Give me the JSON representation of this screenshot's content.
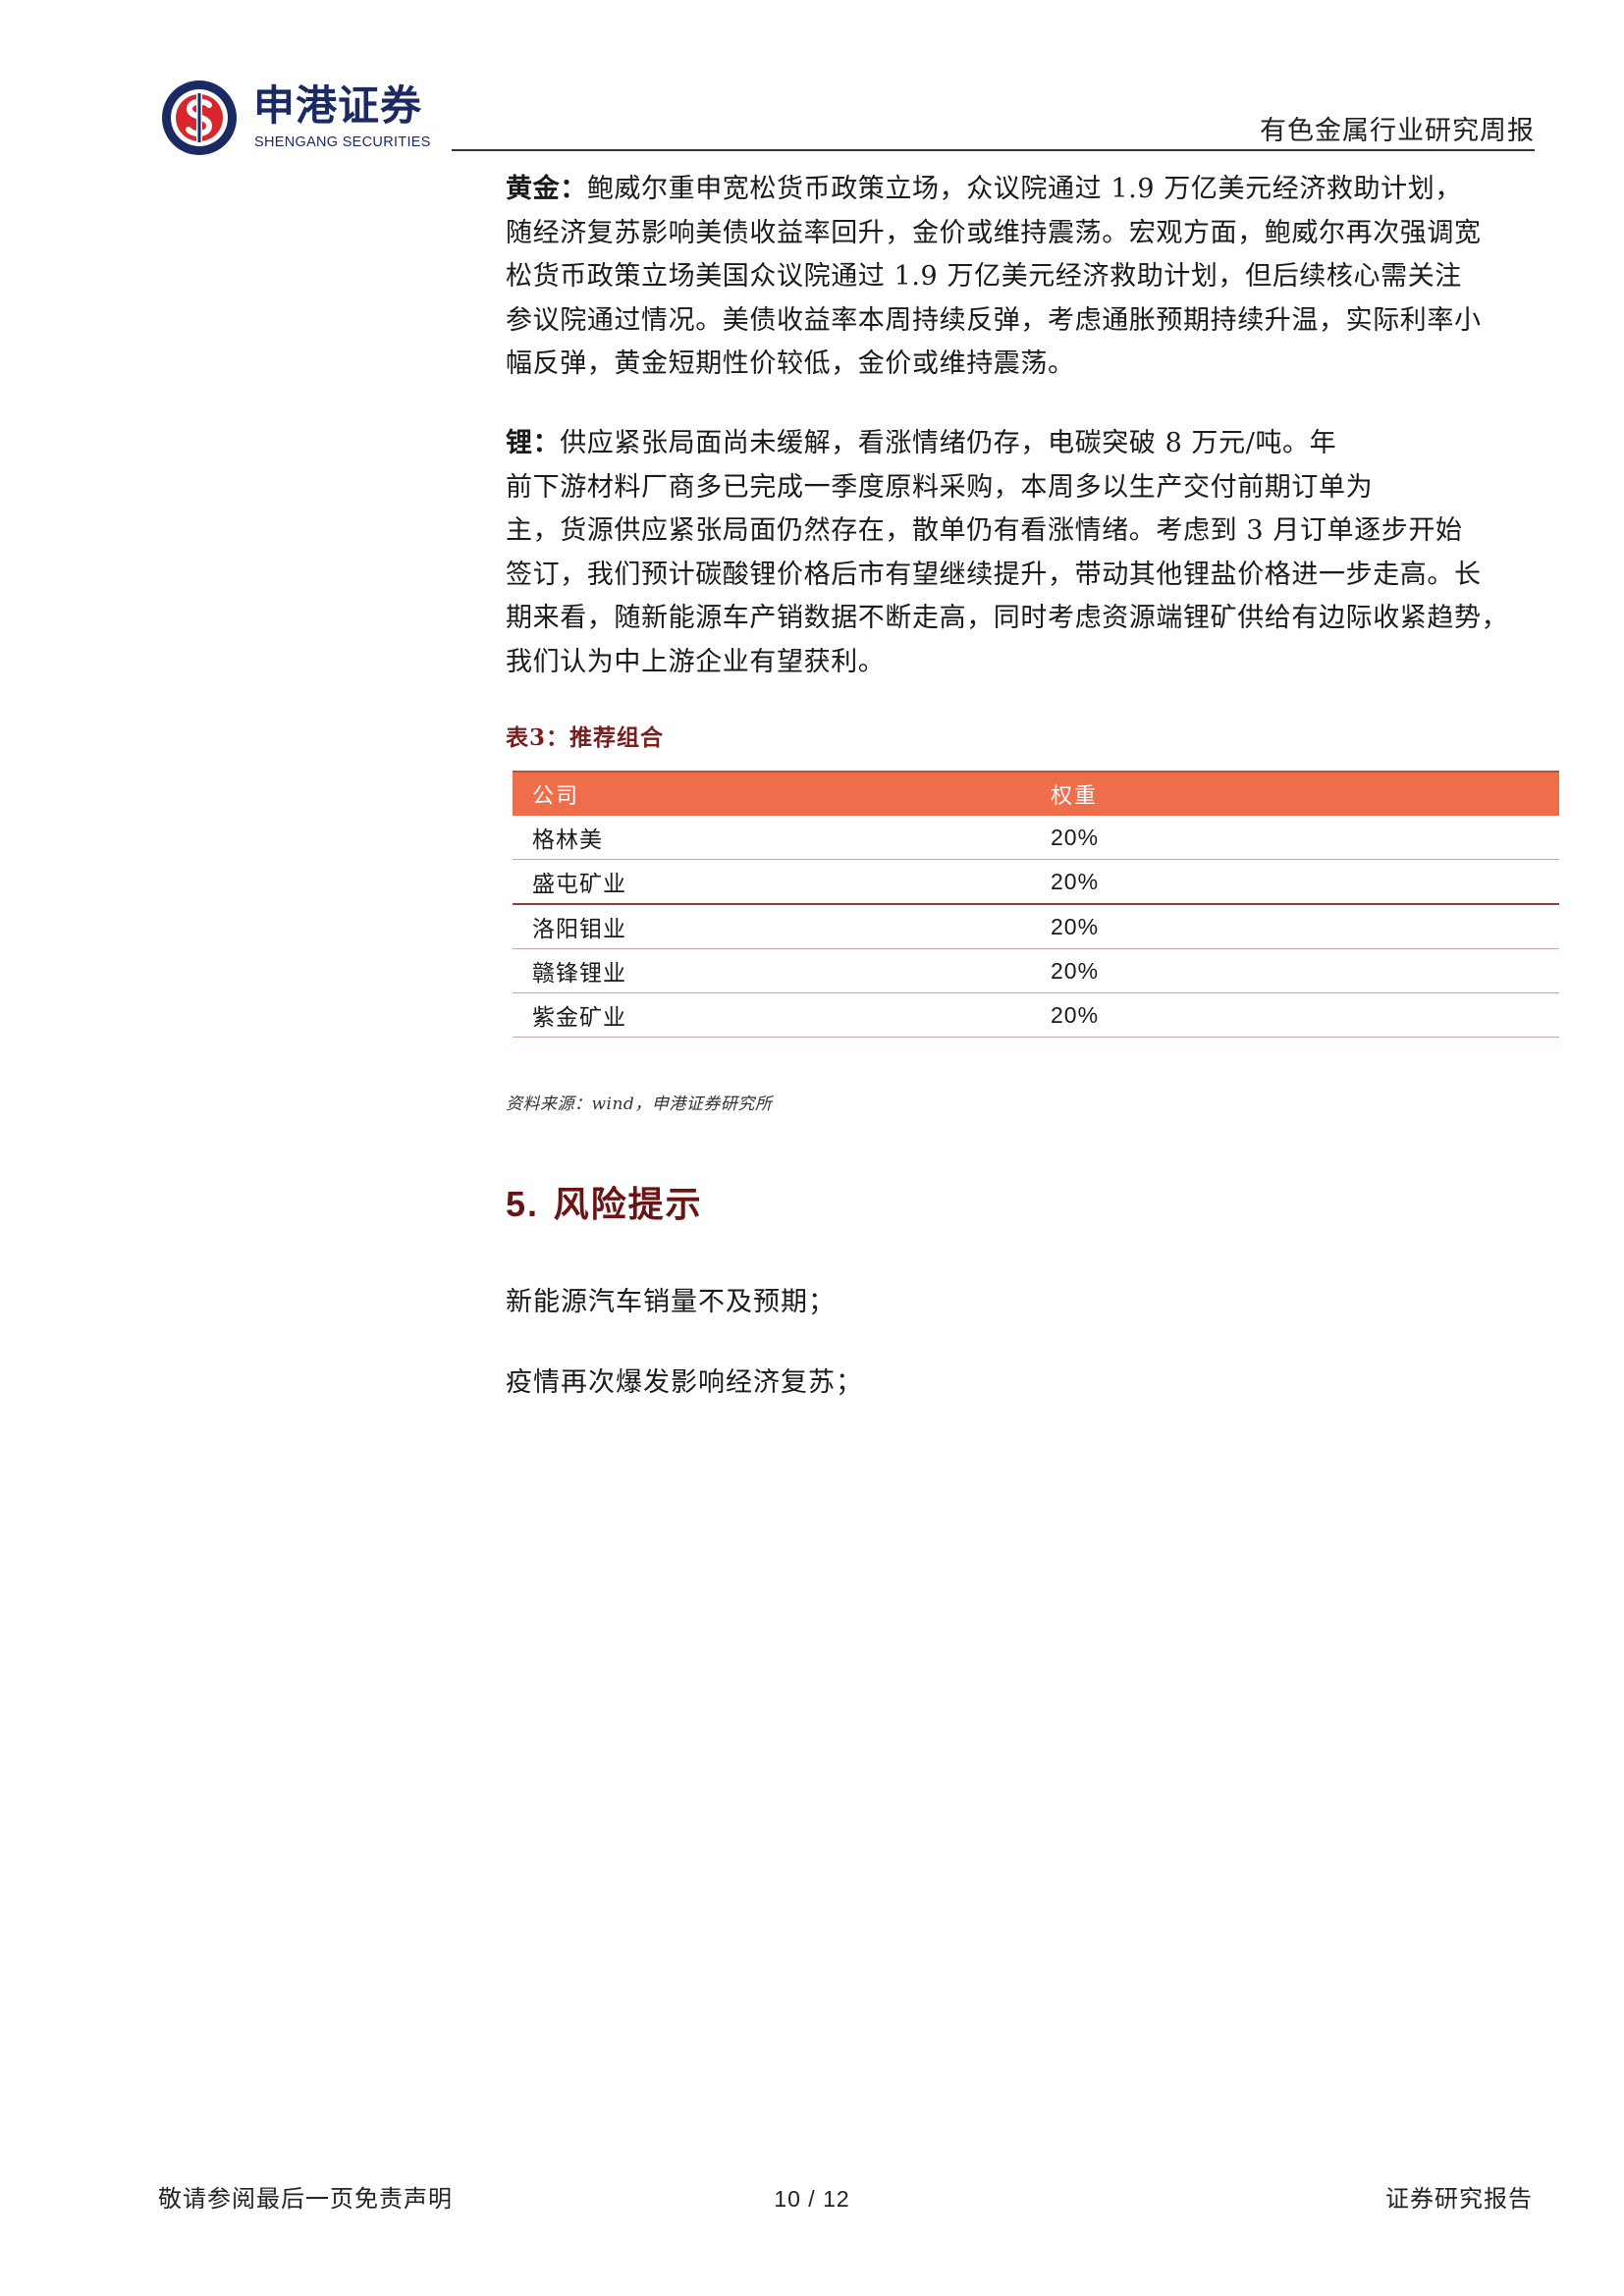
{
  "header": {
    "brand_cn": "申港证券",
    "brand_en": "SHENGANG SECURITIES",
    "report_type": "有色金属行业研究周报",
    "colors": {
      "brand_blue": "#1b2a63",
      "brand_red": "#d7262d"
    }
  },
  "gold": {
    "label": "黄金：",
    "lines": [
      "鲍威尔重申宽松货币政策立场，众议院通过 1.9 万亿美元经济救助计划，",
      "随经济复苏影响美债收益率回升，金价或维持震荡。宏观方面，鲍威尔再次强调宽",
      "松货币政策立场美国众议院通过 1.9 万亿美元经济救助计划，但后续核心需关注",
      "参议院通过情况。美债收益率本周持续反弹，考虑通胀预期持续升温，实际利率小",
      "幅反弹，黄金短期性价较低，金价或维持震荡。"
    ]
  },
  "lithium": {
    "label": "锂：",
    "lines": [
      "供应紧张局面尚未缓解，看涨情绪仍存，电碳突破 8 万元/吨。年",
      "前下游材料厂商多已完成一季度原料采购，本周多以生产交付前期订单为",
      "主，货源供应紧张局面仍然存在，散单仍有看涨情绪。考虑到 3 月订单逐步开始",
      "签订，我们预计碳酸锂价格后市有望继续提升，带动其他锂盐价格进一步走高。长",
      "期来看，随新能源车产销数据不断走高，同时考虑资源端锂矿供给有边际收紧趋势，",
      "我们认为中上游企业有望获利。"
    ]
  },
  "table": {
    "caption": "表3：推荐组合",
    "headers": [
      "公司",
      "权重"
    ],
    "rows": [
      [
        "格林美",
        "20%"
      ],
      [
        "盛屯矿业",
        "20%"
      ],
      [
        "洛阳钼业",
        "20%"
      ],
      [
        "赣锋锂业",
        "20%"
      ],
      [
        "紫金矿业",
        "20%"
      ]
    ],
    "header_color": "#ee6d4b"
  },
  "source_note": "资料来源：wind，申港证券研究所",
  "risk": {
    "number": "5.",
    "title": "风险提示",
    "items": [
      "新能源汽车销量不及预期；",
      "疫情再次爆发影响经济复苏；"
    ]
  },
  "footer": {
    "left": "敬请参阅最后一页免责声明",
    "page": "10 / 12",
    "right": "证券研究报告"
  }
}
